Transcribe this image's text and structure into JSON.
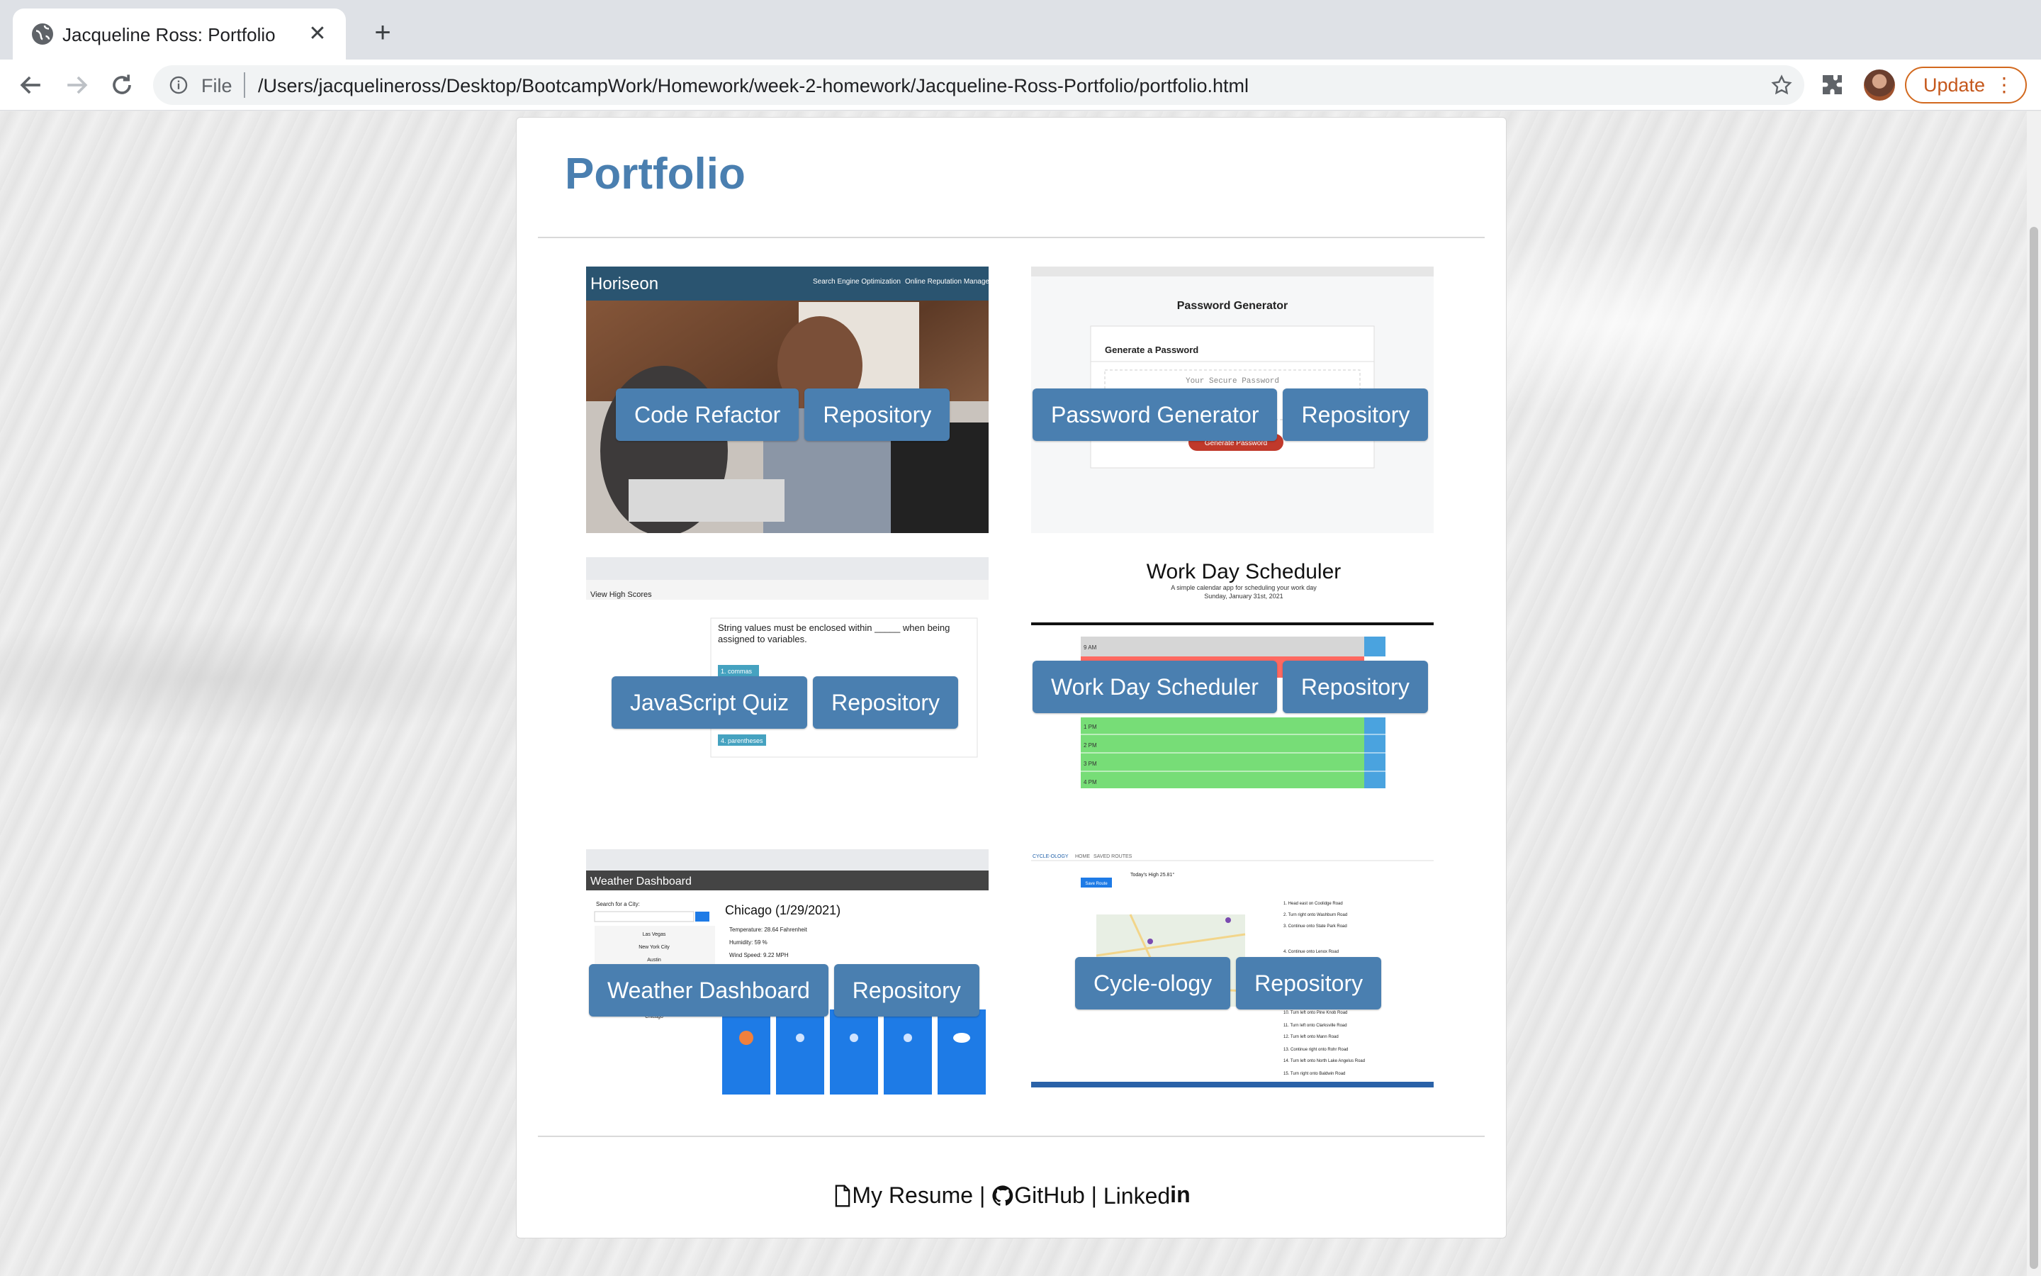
{
  "browser": {
    "tab_title": "Jacqueline Ross: Portfolio",
    "scheme_label": "File",
    "url": "/Users/jacquelineross/Desktop/BootcampWork/Homework/week-2-homework/Jacqueline-Ross-Portfolio/portfolio.html",
    "update_label": "Update"
  },
  "page": {
    "title": "Portfolio"
  },
  "projects": [
    {
      "label": "Code Refactor",
      "repo_label": "Repository",
      "shot": {
        "brand": "Horiseon",
        "nav1": "Search Engine Optimization",
        "nav2": "Online Reputation Managem"
      }
    },
    {
      "label": "Password Generator",
      "repo_label": "Repository",
      "shot": {
        "title": "Password Generator",
        "sub": "Generate a Password",
        "placeholder": "Your Secure Password",
        "button": "Generate Password"
      }
    },
    {
      "label": "JavaScript Quiz",
      "repo_label": "Repository",
      "shot": {
        "link": "View High Scores",
        "question": "String values must be enclosed within _____ when being assigned to variables.",
        "opt1": "1. commas",
        "opt4": "4. parentheses"
      }
    },
    {
      "label": "Work Day Scheduler",
      "repo_label": "Repository",
      "shot": {
        "title": "Work Day Scheduler",
        "sub": "A simple calendar app for scheduling your work day",
        "date": "Sunday, January 31st, 2021",
        "hours": [
          "9 AM",
          "1 PM",
          "2 PM",
          "3 PM",
          "4 PM"
        ]
      }
    },
    {
      "label": "Weather Dashboard",
      "repo_label": "Repository",
      "shot": {
        "header": "Weather Dashboard",
        "search_label": "Search for a City:",
        "cities": [
          "Las Vegas",
          "New York City",
          "Austin",
          "Chicago"
        ],
        "city": "Chicago (1/29/2021)",
        "temp": "Temperature: 28.64 Fahrenheit",
        "humidity": "Humidity: 59 %",
        "wind": "Wind Speed: 9.22 MPH"
      }
    },
    {
      "label": "Cycle-ology",
      "repo_label": "Repository",
      "shot": {
        "nav": [
          "CYCLE-OLOGY",
          "HOME",
          "SAVED ROUTES"
        ],
        "high": "Today's High 25.81°",
        "save": "Save Route",
        "steps": [
          "1. Head east on Coolidge Road",
          "2. Turn right onto Washburn Road",
          "3. Continue onto State Park Road",
          "4. Continue onto Lenox Road",
          "10. Turn left onto Pine Knob Road",
          "11. Turn left onto Clarksville Road",
          "12. Turn left onto Mann Road",
          "13. Continue right onto Rohr Road",
          "14. Turn left onto North Lake Angelus Road",
          "15. Turn right onto Baldwin Road"
        ]
      }
    }
  ],
  "footer": {
    "resume": "My Resume",
    "github": "GitHub",
    "linkedin_prefix": "Linked",
    "linkedin_suffix": "in",
    "sep": "|"
  },
  "colors": {
    "accent": "#4a7fb0",
    "title": "#4a7fb0"
  }
}
